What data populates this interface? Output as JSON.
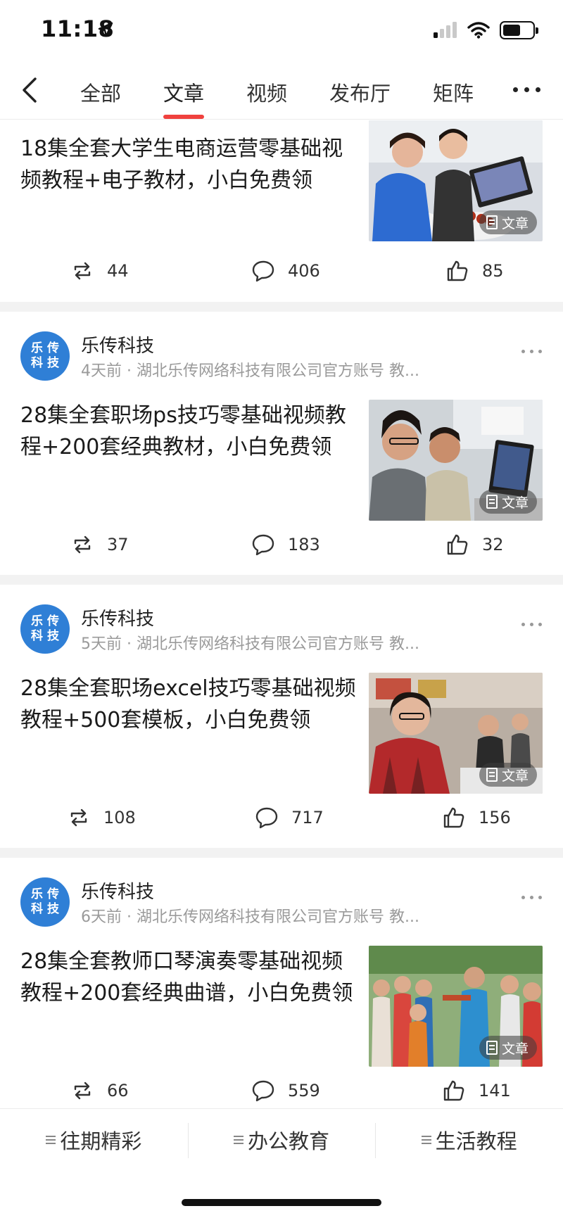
{
  "status_bar": {
    "time": "11:18"
  },
  "tabs": [
    {
      "label": "全部",
      "active": false
    },
    {
      "label": "文章",
      "active": true
    },
    {
      "label": "视频",
      "active": false
    },
    {
      "label": "发布厅",
      "active": false
    },
    {
      "label": "矩阵",
      "active": false
    }
  ],
  "accent_color": "#f0413e",
  "avatar_color": "#2f7fd6",
  "articles": [
    {
      "title": "18集全套大学生电商运营零基础视频教程+电子教材，小白免费领",
      "badge": "文章",
      "reposts": "44",
      "comments": "406",
      "likes": "85"
    },
    {
      "author": "乐传科技",
      "avatar_text_1": "乐传",
      "avatar_text_2": "科技",
      "meta": "4天前 · 湖北乐传网络科技有限公司官方账号 教...",
      "title": "28集全套职场ps技巧零基础视频教程+200套经典教材，小白免费领",
      "badge": "文章",
      "reposts": "37",
      "comments": "183",
      "likes": "32"
    },
    {
      "author": "乐传科技",
      "avatar_text_1": "乐传",
      "avatar_text_2": "科技",
      "meta": "5天前 · 湖北乐传网络科技有限公司官方账号 教...",
      "title": "28集全套职场excel技巧零基础视频教程+500套模板，小白免费领",
      "badge": "文章",
      "reposts": "108",
      "comments": "717",
      "likes": "156"
    },
    {
      "author": "乐传科技",
      "avatar_text_1": "乐传",
      "avatar_text_2": "科技",
      "meta": "6天前 · 湖北乐传网络科技有限公司官方账号 教...",
      "title": "28集全套教师口琴演奏零基础视频教程+200套经典曲谱，小白免费领",
      "badge": "文章",
      "reposts": "66",
      "comments": "559",
      "likes": "141"
    }
  ],
  "bottom_bar": [
    {
      "label": "往期精彩"
    },
    {
      "label": "办公教育"
    },
    {
      "label": "生活教程"
    }
  ],
  "battery_level": 0.6
}
